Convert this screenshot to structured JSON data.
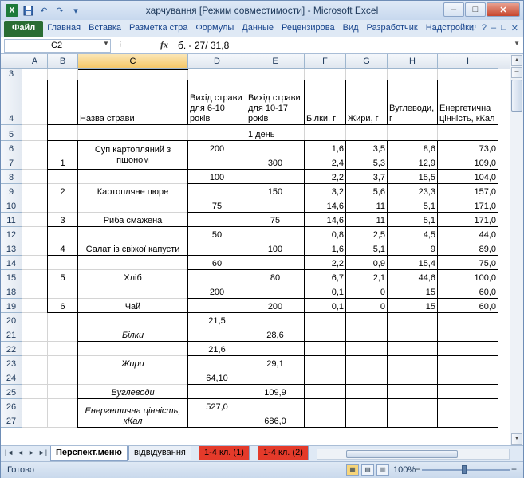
{
  "window": {
    "title": "харчування  [Режим совместимости]  -  Microsoft Excel",
    "controls": {
      "minimize": "–",
      "maximize": "□",
      "close": "✕"
    }
  },
  "qat": {
    "app_icon": "X",
    "save": "💾",
    "undo": "↶",
    "redo": "↷",
    "customize": "▾"
  },
  "ribbon": {
    "tabs": [
      "Файл",
      "Главная",
      "Вставка",
      "Разметка стра",
      "Формулы",
      "Данные",
      "Рецензирова",
      "Вид",
      "Разработчик",
      "Надстройки"
    ],
    "right_icons": [
      "♡",
      "?",
      "–",
      "□",
      "✕"
    ]
  },
  "formula_bar": {
    "name_box": "C2",
    "fx": "fx",
    "formula": "б. - 27/ 31,8"
  },
  "columns": [
    "A",
    "B",
    "C",
    "D",
    "E",
    "F",
    "G",
    "H",
    "I"
  ],
  "selected_column": "C",
  "rows": [
    "3",
    "4",
    "5",
    "6",
    "7",
    "8",
    "9",
    "10",
    "11",
    "12",
    "13",
    "14",
    "15",
    "18",
    "19",
    "20",
    "21",
    "22",
    "23",
    "24",
    "25",
    "26",
    "27"
  ],
  "headers": {
    "name": "Назва страви",
    "out_6_10": "Вихід страви для 6-10 років",
    "out_10_17": "Вихід страви для 10-17 років",
    "protein": "Білки, г",
    "fat": "Жири, г",
    "carbs": "Вуглеводи, г",
    "energy": "Енергетична цінність, кКал"
  },
  "day_label": "1 день",
  "dishes": [
    {
      "num": "1",
      "name": "Суп картопляний з пшоном",
      "d1": "200",
      "d2": "300",
      "r1": [
        "1,6",
        "3,5",
        "8,6",
        "73,0"
      ],
      "r2": [
        "2,4",
        "5,3",
        "12,9",
        "109,0"
      ]
    },
    {
      "num": "2",
      "name": "Картопляне пюре",
      "d1": "100",
      "d2": "150",
      "r1": [
        "2,2",
        "3,7",
        "15,5",
        "104,0"
      ],
      "r2": [
        "3,2",
        "5,6",
        "23,3",
        "157,0"
      ]
    },
    {
      "num": "3",
      "name": "Риба смажена",
      "d1": "75",
      "d2": "75",
      "r1": [
        "14,6",
        "11",
        "5,1",
        "171,0"
      ],
      "r2": [
        "14,6",
        "11",
        "5,1",
        "171,0"
      ]
    },
    {
      "num": "4",
      "name": "Салат із свіжої капусти",
      "d1": "50",
      "d2": "100",
      "r1": [
        "0,8",
        "2,5",
        "4,5",
        "44,0"
      ],
      "r2": [
        "1,6",
        "5,1",
        "9",
        "89,0"
      ]
    },
    {
      "num": "5",
      "name": "Хліб",
      "d1": "60",
      "d2": "80",
      "r1": [
        "2,2",
        "0,9",
        "15,4",
        "75,0"
      ],
      "r2": [
        "6,7",
        "2,1",
        "44,6",
        "100,0"
      ]
    },
    {
      "num": "6",
      "name": "Чай",
      "d1": "200",
      "d2": "200",
      "r1": [
        "0,1",
        "0",
        "15",
        "60,0"
      ],
      "r2": [
        "0,1",
        "0",
        "15",
        "60,0"
      ]
    }
  ],
  "totals": [
    {
      "label": "Білки",
      "d1": "21,5",
      "d2": "28,6"
    },
    {
      "label": "Жири",
      "d1": "21,6",
      "d2": "29,1"
    },
    {
      "label": "Вуглеводи",
      "d1": "64,10",
      "d2": "109,9"
    },
    {
      "label": "Енергетична цінність, кКал",
      "d1": "527,0",
      "d2": "686,0"
    }
  ],
  "sheet_tabs": [
    {
      "label": "Перспект.меню",
      "active": true,
      "red": false
    },
    {
      "label": "відвідування",
      "active": false,
      "red": false
    },
    {
      "label": "1-4 кл.  (1)",
      "active": false,
      "red": true
    },
    {
      "label": "1-4 кл.  (2)",
      "active": false,
      "red": true
    }
  ],
  "status": {
    "text": "Готово",
    "zoom": "100%"
  },
  "colors": {
    "accent": "#2a6d33",
    "selected_header": "#f5c869",
    "red_tab": "#e43a2a"
  }
}
